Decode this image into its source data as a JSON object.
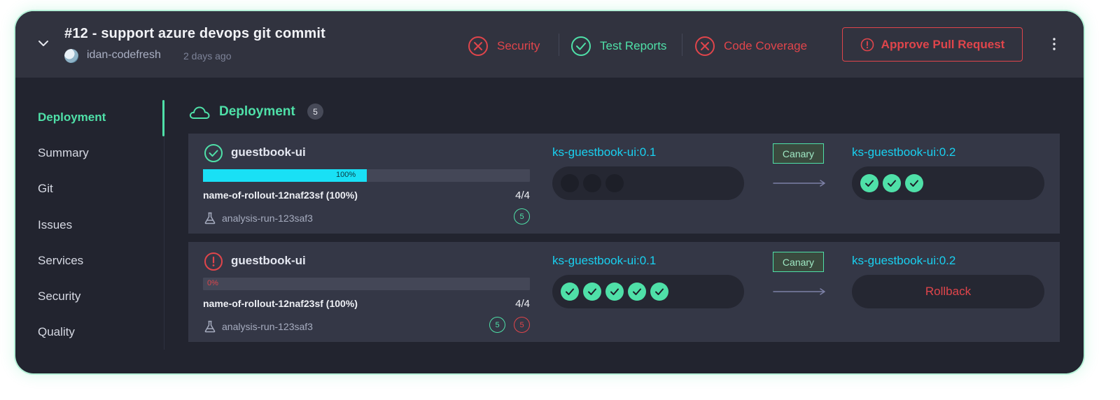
{
  "header": {
    "title": "#12 - support azure devops git commit",
    "author": "idan-codefresh",
    "time": "2 days ago",
    "statuses": [
      {
        "label": "Security",
        "state": "error"
      },
      {
        "label": "Test Reports",
        "state": "success"
      },
      {
        "label": "Code Coverage",
        "state": "error"
      }
    ],
    "approve_label": "Approve Pull Request"
  },
  "sidebar": {
    "items": [
      {
        "label": "Deployment",
        "active": true
      },
      {
        "label": "Summary"
      },
      {
        "label": "Git"
      },
      {
        "label": "Issues"
      },
      {
        "label": "Services"
      },
      {
        "label": "Security"
      },
      {
        "label": "Quality"
      }
    ]
  },
  "section": {
    "title": "Deployment",
    "count": "5"
  },
  "rows": [
    {
      "status": "success",
      "name": "guestbook-ui",
      "progress": 0.5,
      "progress_label": "100%",
      "rollout": "name-of-rollout-12naf23sf (100%)",
      "ratio": "4/4",
      "analysis": "analysis-run-123saf3",
      "badges": [
        {
          "value": "5",
          "color": "green"
        }
      ],
      "from_image": "ks-guestbook-ui:0.1",
      "to_image": "ks-guestbook-ui:0.2",
      "strategy": "Canary",
      "from_pods": {
        "ok": 0,
        "pending": 3
      },
      "to_pods": {
        "ok": 3
      }
    },
    {
      "status": "error",
      "name": "guestbook-ui",
      "progress": 0,
      "progress_label": "0%",
      "rollout": "name-of-rollout-12naf23sf (100%)",
      "ratio": "4/4",
      "analysis": "analysis-run-123saf3",
      "badges": [
        {
          "value": "5",
          "color": "green"
        },
        {
          "value": "5",
          "color": "red"
        }
      ],
      "from_image": "ks-guestbook-ui:0.1",
      "to_image": "ks-guestbook-ui:0.2",
      "strategy": "Canary",
      "from_pods": {
        "ok": 5,
        "pending": 0
      },
      "to_action": "Rollback"
    }
  ],
  "colors": {
    "accent": "#4fe0a8",
    "error": "#e0454b",
    "cyan": "#19e0f5",
    "background": "#22242f",
    "header": "#31333f"
  }
}
